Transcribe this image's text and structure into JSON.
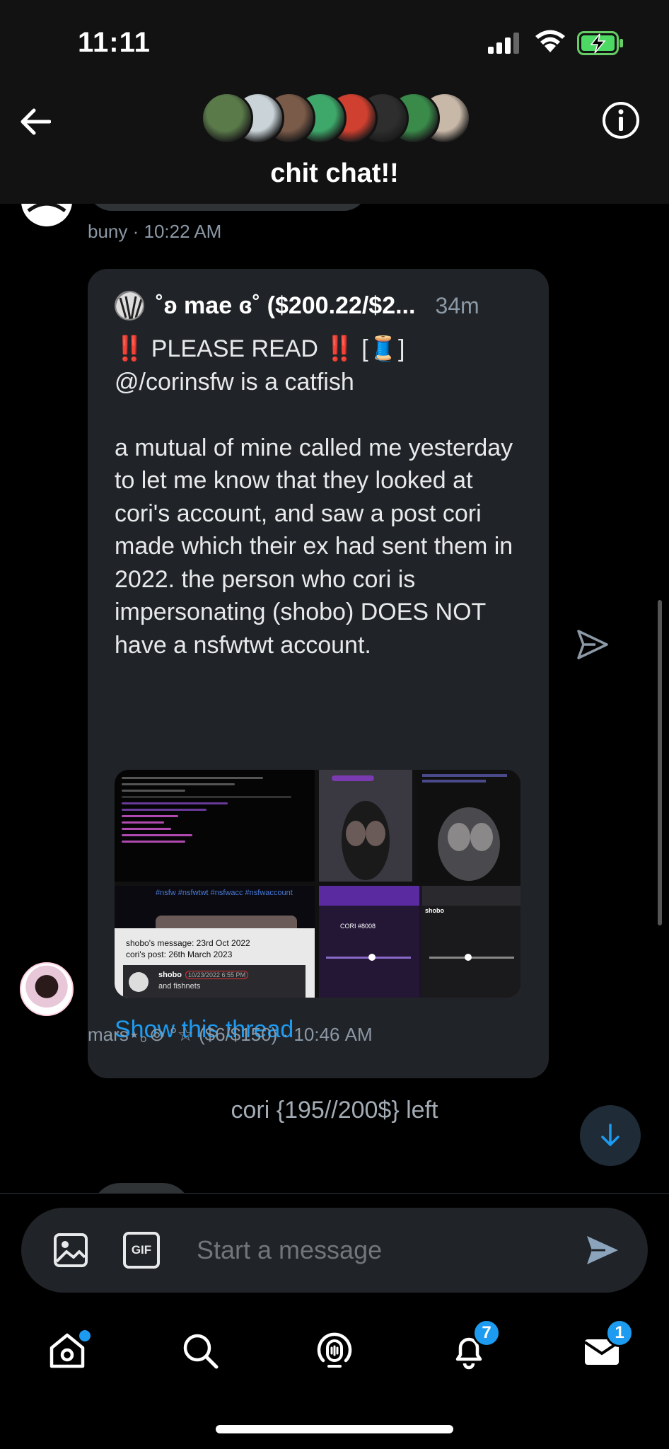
{
  "status_bar": {
    "time": "11:11"
  },
  "header": {
    "title": "chit chat!!",
    "avatar_colors": [
      "#5a7a4a",
      "#c9d3d8",
      "#7a5a48",
      "#3ea86a",
      "#d04030",
      "#2e2e2e",
      "#3a8a4a",
      "#c8b8a8"
    ]
  },
  "messages": {
    "prev_meta": "buny · 10:22 AM",
    "quoted": {
      "name": "˚ʚ mae ɞ˚ ($200.22/$2...",
      "time": "34m",
      "text": "‼️ PLEASE READ ‼️ [🧵]\n@/corinsfw is a catfish\n\na mutual of mine called me yesterday to let me know that they looked at cori's account, and saw a post cori made which their ex had sent them in 2022. the person who cori is impersonating (shobo) DOES NOT have a nsfwtwt account.",
      "media": {
        "tile4_tags": "#nsfw #nsfwtwt #nsfwacc #nsfwaccount",
        "tile4_line1": "shobo's message: 23rd Oct 2022",
        "tile4_line2": "cori's post: 26th March 2023",
        "tile4_name": "shobo",
        "tile4_date": "10/23/2022 6:55 PM",
        "tile4_msg": "and fishnets",
        "tile5_label": "CORI #8008",
        "tile5b_label": "shobo"
      },
      "show_thread": "Show this thread"
    },
    "mars_meta": "mars⋆｡⊚ °☆ ($6/$150) · 10:46 AM",
    "system": "cori {195//200$} left"
  },
  "composer": {
    "placeholder": "Start a message",
    "gif_label": "GIF"
  },
  "tabbar": {
    "notifications_badge": "7",
    "messages_badge": "1"
  },
  "colors": {
    "accent": "#1d9bf0",
    "bubble": "#202327",
    "background": "#000000"
  }
}
